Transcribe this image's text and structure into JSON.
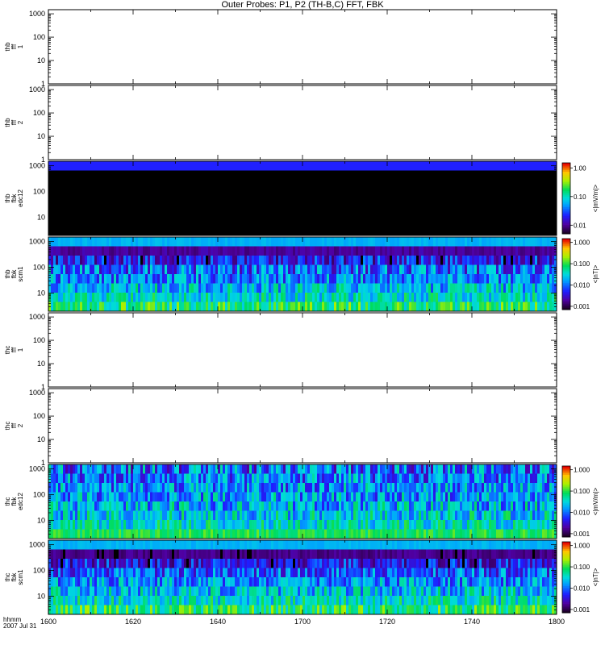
{
  "title": "Outer Probes: P1, P2 (TH-B,C) FFT, FBK",
  "x_axis": {
    "ticks": [
      "1600",
      "1620",
      "1640",
      "1700",
      "1720",
      "1740",
      "1800"
    ],
    "label_line1": "hhmm",
    "label_line2": "2007 Jul 31"
  },
  "chart_data": [
    {
      "type": "heatmap",
      "panel_label": [
        "thb",
        "fff",
        "1"
      ],
      "y_ticks": [
        "1",
        "10",
        "100",
        "1000"
      ],
      "y_log_range": [
        1,
        1500
      ],
      "data": "empty"
    },
    {
      "type": "heatmap",
      "panel_label": [
        "thb",
        "fff",
        "2"
      ],
      "y_ticks": [
        "1",
        "10",
        "100",
        "1000"
      ],
      "y_log_range": [
        1,
        1500
      ],
      "data": "empty"
    },
    {
      "type": "heatmap",
      "panel_label": [
        "thb",
        "fbk",
        "edc12"
      ],
      "y_ticks": [
        "10",
        "100",
        "1000"
      ],
      "y_log_range": [
        2,
        1500
      ],
      "colorbar": {
        "ticks": [
          "0.01",
          "0.10",
          "1.00"
        ],
        "unit": "<|mV/m|>",
        "range": [
          0.005,
          1.5
        ]
      },
      "bands": [
        {
          "level": 0.5,
          "variance": 0.5,
          "color": "#2020ff"
        },
        {
          "level": 0,
          "variance": 0,
          "color": "#000000"
        },
        {
          "level": 0,
          "variance": 0,
          "color": "#000000"
        },
        {
          "level": 0,
          "variance": 0,
          "color": "#000000"
        },
        {
          "level": 0,
          "variance": 0,
          "color": "#000000"
        },
        {
          "level": 0,
          "variance": 0,
          "color": "#000000"
        },
        {
          "level": 0,
          "variance": 0,
          "color": "#000000"
        },
        {
          "level": 0,
          "variance": 0,
          "color": "#000000"
        }
      ]
    },
    {
      "type": "heatmap",
      "panel_label": [
        "thb",
        "fbk",
        "scm1"
      ],
      "y_ticks": [
        "10",
        "100",
        "1000"
      ],
      "y_log_range": [
        2,
        1500
      ],
      "colorbar": {
        "ticks": [
          "0.001",
          "0.010",
          "0.100",
          "1.000"
        ],
        "unit": "<|nT|>",
        "range": [
          0.0007,
          1.5
        ]
      },
      "bands": [
        {
          "level": 0.42,
          "variance": 0.05
        },
        {
          "level": 0.1,
          "variance": 0.08
        },
        {
          "level": 0.15,
          "variance": 0.35
        },
        {
          "level": 0.25,
          "variance": 0.4
        },
        {
          "level": 0.3,
          "variance": 0.35
        },
        {
          "level": 0.38,
          "variance": 0.35
        },
        {
          "level": 0.45,
          "variance": 0.3
        },
        {
          "level": 0.55,
          "variance": 0.3
        }
      ]
    },
    {
      "type": "heatmap",
      "panel_label": [
        "thc",
        "fff",
        "1"
      ],
      "y_ticks": [
        "1",
        "10",
        "100",
        "1000"
      ],
      "y_log_range": [
        1,
        1500
      ],
      "data": "empty"
    },
    {
      "type": "heatmap",
      "panel_label": [
        "thc",
        "fff",
        "2"
      ],
      "y_ticks": [
        "1",
        "10",
        "100",
        "1000"
      ],
      "y_log_range": [
        1,
        1500
      ],
      "data": "empty"
    },
    {
      "type": "heatmap",
      "panel_label": [
        "thc",
        "fbk",
        "edc12"
      ],
      "y_ticks": [
        "10",
        "100",
        "1000"
      ],
      "y_log_range": [
        2,
        1500
      ],
      "colorbar": {
        "ticks": [
          "0.001",
          "0.010",
          "0.100",
          "1.000"
        ],
        "unit": "<|mV/m|>",
        "range": [
          0.0007,
          1.5
        ]
      },
      "bands": [
        {
          "level": 0.25,
          "variance": 0.45
        },
        {
          "level": 0.28,
          "variance": 0.4
        },
        {
          "level": 0.3,
          "variance": 0.4
        },
        {
          "level": 0.32,
          "variance": 0.4
        },
        {
          "level": 0.35,
          "variance": 0.4
        },
        {
          "level": 0.4,
          "variance": 0.35
        },
        {
          "level": 0.45,
          "variance": 0.3
        },
        {
          "level": 0.6,
          "variance": 0.15
        }
      ]
    },
    {
      "type": "heatmap",
      "panel_label": [
        "thc",
        "fbk",
        "scm1"
      ],
      "y_ticks": [
        "10",
        "100",
        "1000"
      ],
      "y_log_range": [
        2,
        1500
      ],
      "colorbar": {
        "ticks": [
          "0.001",
          "0.010",
          "0.100",
          "1.000"
        ],
        "unit": "<|nT|>",
        "range": [
          0.0007,
          1.5
        ]
      },
      "bands": [
        {
          "level": 0.42,
          "variance": 0.05
        },
        {
          "level": 0.08,
          "variance": 0.08
        },
        {
          "level": 0.15,
          "variance": 0.35
        },
        {
          "level": 0.25,
          "variance": 0.35
        },
        {
          "level": 0.32,
          "variance": 0.35
        },
        {
          "level": 0.38,
          "variance": 0.35
        },
        {
          "level": 0.45,
          "variance": 0.3
        },
        {
          "level": 0.55,
          "variance": 0.3
        }
      ]
    }
  ]
}
